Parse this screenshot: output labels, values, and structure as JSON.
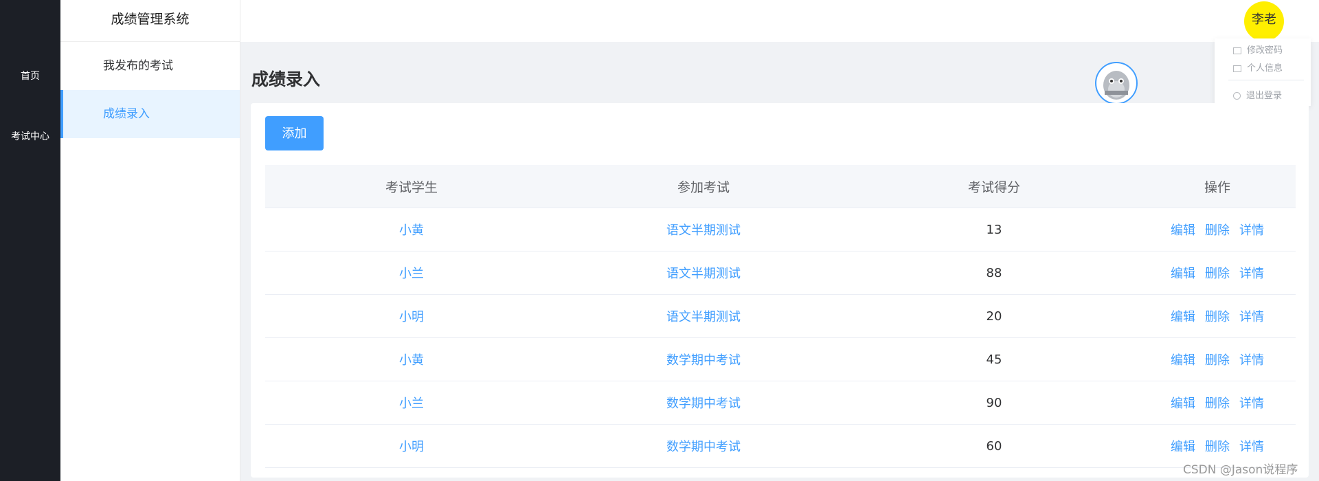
{
  "leftnav": {
    "items": [
      {
        "label": "首页"
      },
      {
        "label": "考试中心"
      }
    ]
  },
  "sidebar": {
    "brand": "成绩管理系统",
    "items": [
      {
        "label": "我发布的考试"
      },
      {
        "label": "成绩录入"
      }
    ]
  },
  "header": {
    "user_name": "李老",
    "user_menu": [
      {
        "label": "修改密码"
      },
      {
        "label": "个人信息"
      },
      {
        "label": "退出登录"
      }
    ]
  },
  "main": {
    "title": "成绩录入",
    "add_label": "添加",
    "columns": [
      "考试学生",
      "参加考试",
      "考试得分",
      "操作"
    ],
    "rows": [
      {
        "student": "小黄",
        "exam": "语文半期测试",
        "score": "13"
      },
      {
        "student": "小兰",
        "exam": "语文半期测试",
        "score": "88"
      },
      {
        "student": "小明",
        "exam": "语文半期测试",
        "score": "20"
      },
      {
        "student": "小黄",
        "exam": "数学期中考试",
        "score": "45"
      },
      {
        "student": "小兰",
        "exam": "数学期中考试",
        "score": "90"
      },
      {
        "student": "小明",
        "exam": "数学期中考试",
        "score": "60"
      }
    ],
    "actions": {
      "edit": "编辑",
      "delete": "删除",
      "detail": "详情"
    }
  },
  "watermark": "CSDN @Jason说程序",
  "colors": {
    "primary": "#409eff",
    "nav_bg": "#1c1f26",
    "active_bg": "#e8f4ff",
    "user_badge": "#ffef00"
  }
}
